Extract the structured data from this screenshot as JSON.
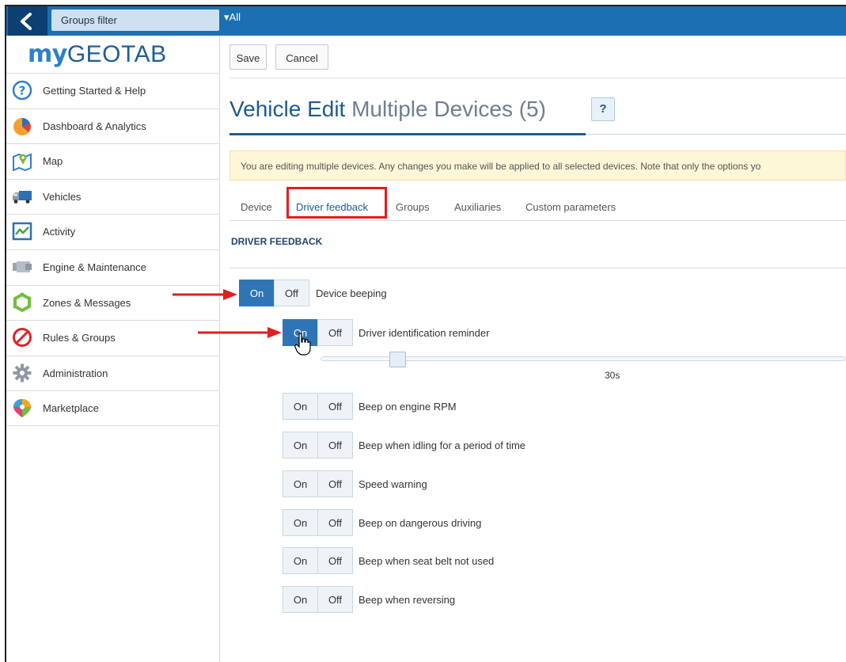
{
  "topbar": {
    "groups_filter": "Groups filter",
    "all_label": "▾All"
  },
  "sidebar": {
    "logo_my": "my",
    "logo_geotab": "GEOTAB",
    "items": [
      {
        "label": "Getting Started & Help",
        "icon": "help-icon"
      },
      {
        "label": "Dashboard & Analytics",
        "icon": "pie-chart-icon"
      },
      {
        "label": "Map",
        "icon": "map-icon"
      },
      {
        "label": "Vehicles",
        "icon": "truck-icon"
      },
      {
        "label": "Activity",
        "icon": "activity-icon"
      },
      {
        "label": "Engine & Maintenance",
        "icon": "engine-icon"
      },
      {
        "label": "Zones & Messages",
        "icon": "zone-icon"
      },
      {
        "label": "Rules & Groups",
        "icon": "rules-icon"
      },
      {
        "label": "Administration",
        "icon": "gear-icon"
      },
      {
        "label": "Marketplace",
        "icon": "marketplace-icon"
      }
    ]
  },
  "toolbar": {
    "save_label": "Save",
    "cancel_label": "Cancel"
  },
  "page": {
    "title_main": "Vehicle Edit",
    "title_sub": "Multiple Devices (5)",
    "help_label": "?",
    "notice": "You are editing multiple devices. Any changes you make will be applied to all selected devices. Note that only the options yo"
  },
  "tabs": [
    "Device",
    "Driver feedback",
    "Groups",
    "Auxiliaries",
    "Custom parameters"
  ],
  "active_tab": "Driver feedback",
  "section_title": "DRIVER FEEDBACK",
  "toggles": [
    {
      "label": "Device beeping",
      "on": "On",
      "off": "Off",
      "state": "on"
    },
    {
      "label": "Driver identification reminder",
      "on": "On",
      "off": "Off",
      "state": "on"
    },
    {
      "label": "Beep on engine RPM",
      "on": "On",
      "off": "Off",
      "state": "unset"
    },
    {
      "label": "Beep when idling for a period of time",
      "on": "On",
      "off": "Off",
      "state": "unset"
    },
    {
      "label": "Speed warning",
      "on": "On",
      "off": "Off",
      "state": "unset"
    },
    {
      "label": "Beep on dangerous driving",
      "on": "On",
      "off": "Off",
      "state": "unset"
    },
    {
      "label": "Beep when seat belt not used",
      "on": "On",
      "off": "Off",
      "state": "unset"
    },
    {
      "label": "Beep when reversing",
      "on": "On",
      "off": "Off",
      "state": "unset"
    }
  ],
  "reminder_slider": {
    "value_label": "30s"
  },
  "colors": {
    "accent": "#2f75b5",
    "topbar": "#1b6fb3",
    "highlight": "#e01f1f"
  }
}
